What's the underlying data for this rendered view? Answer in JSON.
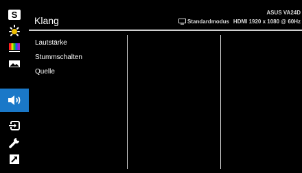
{
  "sidebar": {
    "items": [
      {
        "name": "splendid-s-icon",
        "glyph": "S"
      },
      {
        "name": "blue-light-filter-icon"
      },
      {
        "name": "color-bars-icon"
      },
      {
        "name": "image-icon"
      },
      {
        "name": "speaker-icon",
        "active": true
      },
      {
        "name": "input-select-icon"
      },
      {
        "name": "wrench-icon"
      },
      {
        "name": "shortcut-arrow-icon"
      }
    ],
    "active_color": "#1a78c8"
  },
  "header": {
    "title": "Klang",
    "model": "ASUS VA24D",
    "mode": "Standardmodus",
    "signal": "HDMI 1920 x 1080 @ 60Hz"
  },
  "menu": {
    "items": [
      "Lautstärke",
      "Stummschalten",
      "Quelle"
    ]
  }
}
